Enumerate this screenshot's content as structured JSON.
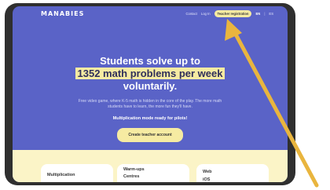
{
  "brand": {
    "logo_text": "MANABIES"
  },
  "nav": {
    "contact": "Contact",
    "login": "Log In",
    "teacher_registration": "Teacher registration",
    "lang_active": "EN",
    "lang_separator": "|",
    "lang_other": "ES"
  },
  "hero": {
    "headline_line1": "Students solve up to",
    "headline_highlight": "1352 math problems per week",
    "headline_line3": "voluntarily.",
    "subtitle": "Free video game, where K-5 math is hidden in the core of the play. The more math students have to learn, the more fun they'll have.",
    "note": "Multiplication mode ready for pilots!",
    "cta_label": "Create teacher account"
  },
  "cards": [
    {
      "lines": [
        "Multiplication"
      ]
    },
    {
      "lines": [
        "Warm-ups",
        "Centres"
      ]
    },
    {
      "lines": [
        "Web",
        "iOS"
      ]
    }
  ],
  "colors": {
    "hero_bg": "#5a63c7",
    "accent_yellow": "#f6eba2",
    "lower_bg": "#fbf4c7",
    "device_frame": "#2f2f2f",
    "annotation_arrow": "#e9b53e"
  },
  "icons": {
    "annotation": "arrow-pointer-icon"
  }
}
